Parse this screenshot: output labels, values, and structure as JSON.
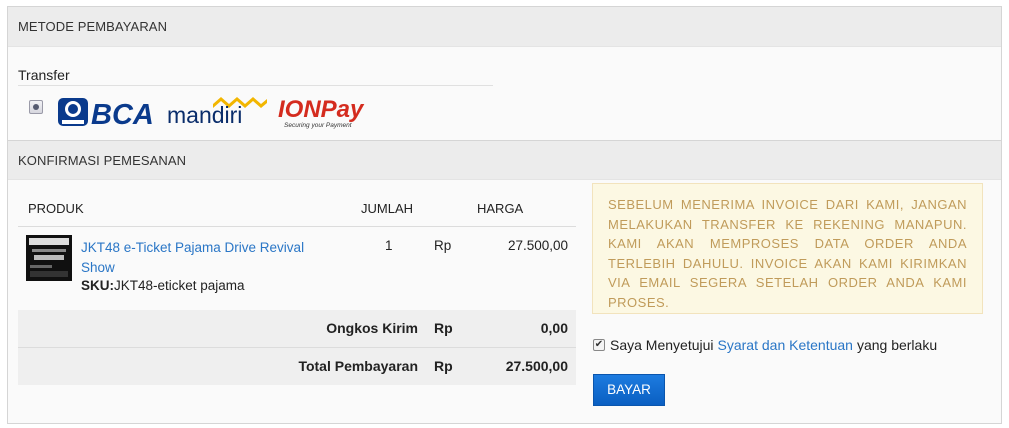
{
  "metode": {
    "header": "METODE PEMBAYARAN",
    "transfer_label": "Transfer",
    "logos": {
      "bca": "BCA",
      "mandiri": "mandiri",
      "ionpay_main": "IONPay",
      "ionpay_tag": "Securing your Payment"
    }
  },
  "konfirmasi": {
    "header": "KONFIRMASI PEMESANAN",
    "columns": {
      "produk": "PRODUK",
      "jumlah": "JUMLAH",
      "harga": "HARGA"
    },
    "item": {
      "name": "JKT48 e-Ticket Pajama Drive Revival Show",
      "sku_label": "SKU:",
      "sku_value": "JKT48-eticket pajama",
      "qty": "1",
      "currency": "Rp",
      "price": "27.500,00"
    },
    "ongkos": {
      "label": "Ongkos Kirim",
      "currency": "Rp",
      "value": "0,00"
    },
    "total": {
      "label": "Total Pembayaran",
      "currency": "Rp",
      "value": "27.500,00"
    }
  },
  "notice": "SEBELUM MENERIMA INVOICE DARI KAMI, JANGAN MELAKUKAN TRANSFER KE REKENING MANAPUN. KAMI AKAN MEMPROSES DATA ORDER ANDA TERLEBIH DAHULU. INVOICE AKAN KAMI KIRIMKAN VIA EMAIL SEGERA SETELAH ORDER ANDA KAMI PROSES.",
  "agreement": {
    "checked": true,
    "prefix": "Saya Menyetujui",
    "link": "Syarat dan Ketentuan",
    "suffix": "yang berlaku"
  },
  "button_bayar": "BAYAR",
  "colors": {
    "link": "#2a76c6",
    "button": "#0a5fc2",
    "notice_bg": "#fcf8e3",
    "notice_text": "#c09b5a"
  }
}
